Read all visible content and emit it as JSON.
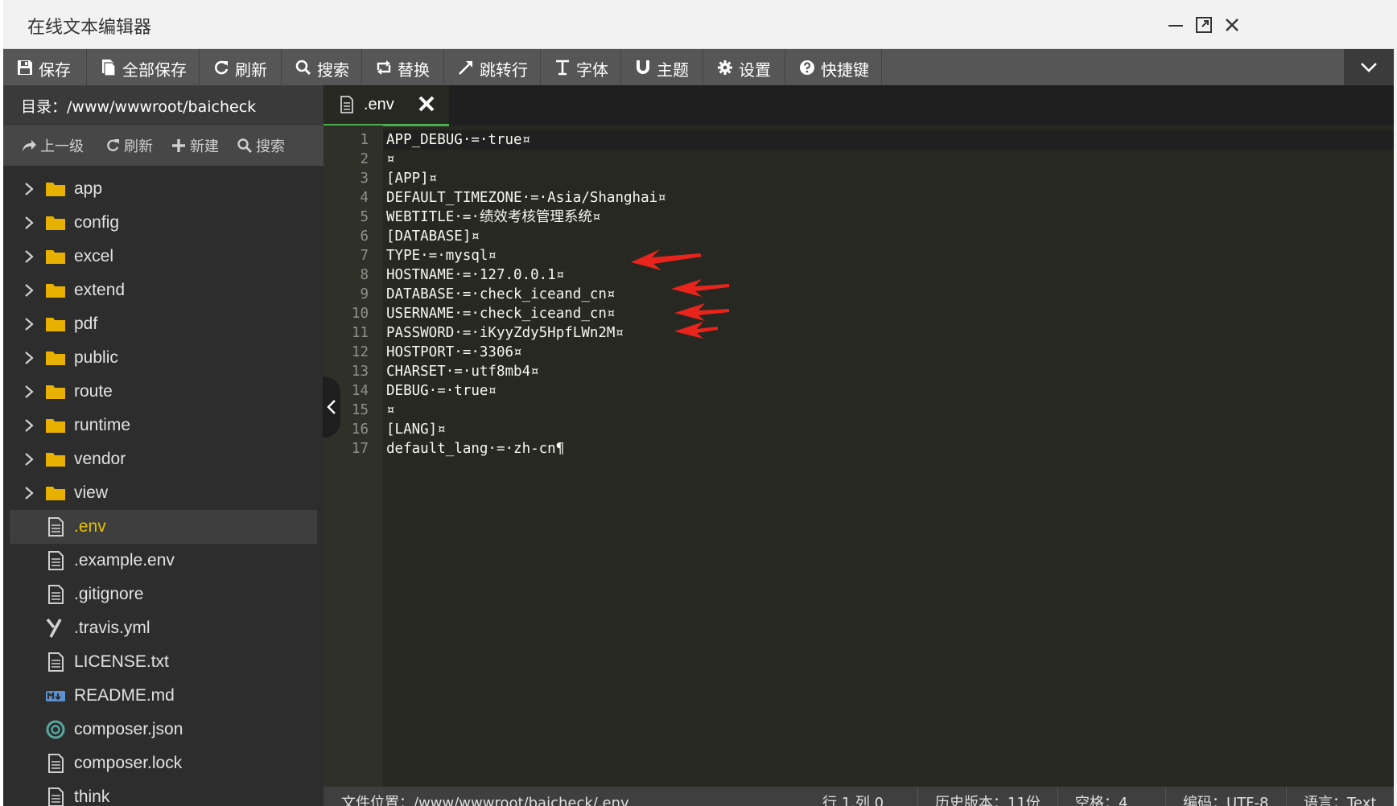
{
  "window": {
    "title": "在线文本编辑器"
  },
  "toolbar": {
    "save": "保存",
    "save_all": "全部保存",
    "refresh": "刷新",
    "search": "搜索",
    "replace": "替换",
    "goto_line": "跳转行",
    "font": "字体",
    "theme": "主题",
    "settings": "设置",
    "shortcuts": "快捷键"
  },
  "sidebar": {
    "directory_label": "目录：/www/wwwroot/baicheck",
    "tools": {
      "up": "上一级",
      "refresh": "刷新",
      "new": "新建",
      "search": "搜索"
    },
    "folders": [
      "app",
      "config",
      "excel",
      "extend",
      "pdf",
      "public",
      "route",
      "runtime",
      "vendor",
      "view"
    ],
    "files": [
      {
        "name": ".env",
        "icon": "file-icon",
        "active": true
      },
      {
        "name": ".example.env",
        "icon": "file-icon"
      },
      {
        "name": ".gitignore",
        "icon": "file-icon"
      },
      {
        "name": ".travis.yml",
        "icon": "yaml-icon"
      },
      {
        "name": "LICENSE.txt",
        "icon": "file-icon"
      },
      {
        "name": "README.md",
        "icon": "markdown-icon"
      },
      {
        "name": "composer.json",
        "icon": "json-icon"
      },
      {
        "name": "composer.lock",
        "icon": "file-icon"
      },
      {
        "name": "think",
        "icon": "file-icon"
      }
    ]
  },
  "editor": {
    "tab": {
      "title": ".env"
    },
    "lines": [
      {
        "n": "1",
        "text": "APP_DEBUG·=·true¤"
      },
      {
        "n": "2",
        "text": "¤"
      },
      {
        "n": "3",
        "text": "[APP]¤"
      },
      {
        "n": "4",
        "text": "DEFAULT_TIMEZONE·=·Asia/Shanghai¤"
      },
      {
        "n": "5",
        "text": "WEBTITLE·=·绩效考核管理系统¤"
      },
      {
        "n": "6",
        "text": "[DATABASE]¤"
      },
      {
        "n": "7",
        "text": "TYPE·=·mysql¤"
      },
      {
        "n": "8",
        "text": "HOSTNAME·=·127.0.0.1¤"
      },
      {
        "n": "9",
        "text": "DATABASE·=·check_iceand_cn¤"
      },
      {
        "n": "10",
        "text": "USERNAME·=·check_iceand_cn¤"
      },
      {
        "n": "11",
        "text": "PASSWORD·=·iKyyZdy5HpfLWn2M¤"
      },
      {
        "n": "12",
        "text": "HOSTPORT·=·3306¤"
      },
      {
        "n": "13",
        "text": "CHARSET·=·utf8mb4¤"
      },
      {
        "n": "14",
        "text": "DEBUG·=·true¤"
      },
      {
        "n": "15",
        "text": "¤"
      },
      {
        "n": "16",
        "text": "[LANG]¤"
      },
      {
        "n": "17",
        "text": "default_lang·=·zh-cn¶"
      }
    ]
  },
  "status_bar": {
    "file_path": "文件位置：/www/wwwroot/baicheck/.env",
    "cursor": "行 1,列 0",
    "history": "历史版本：11份",
    "indent": "空格：4",
    "encoding": "编码：UTF-8",
    "language": "语言：Text"
  },
  "colors": {
    "accent_tab": "#4cae4c",
    "active_file": "#e6c000",
    "annotation_arrow": "#e8241c"
  }
}
